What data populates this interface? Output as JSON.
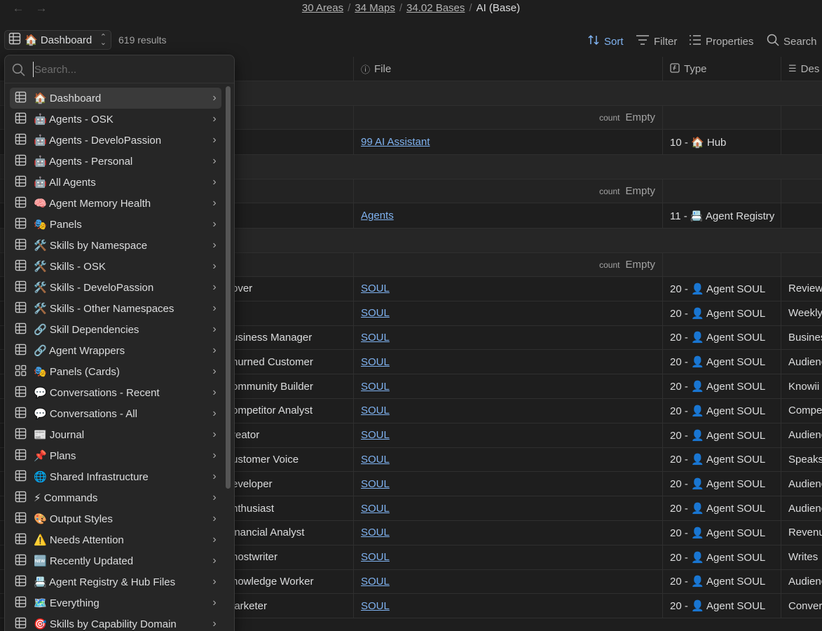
{
  "nav": {
    "back_icon": "arrow-left-icon",
    "forward_icon": "arrow-right-icon"
  },
  "breadcrumb": {
    "items": [
      "30 Areas",
      "34 Maps",
      "34.02 Bases"
    ],
    "current": "AI (Base)"
  },
  "toolbar": {
    "view_label": "🏠 Dashboard",
    "results": "619 results",
    "sort": "Sort",
    "filter": "Filter",
    "properties": "Properties",
    "search": "Search"
  },
  "table": {
    "headers": {
      "file": "File",
      "type": "Type",
      "description": "Des"
    },
    "summary": {
      "count_label": "count",
      "empty_label": "Empty"
    },
    "rows": [
      {
        "kind": "group"
      },
      {
        "kind": "summary"
      },
      {
        "kind": "data",
        "name": "",
        "file": "99 AI Assistant",
        "type": "10 - 🏠 Hub",
        "desc": ""
      },
      {
        "kind": "group"
      },
      {
        "kind": "summary"
      },
      {
        "kind": "data",
        "name": "",
        "file": "Agents",
        "type": "11 - 📇 Agent Registry",
        "desc": ""
      },
      {
        "kind": "group"
      },
      {
        "kind": "summary"
      },
      {
        "kind": "data",
        "name": "over",
        "file": "SOUL",
        "type": "20 - 👤 Agent SOUL",
        "desc": "Review"
      },
      {
        "kind": "data",
        "name": "",
        "file": "SOUL",
        "type": "20 - 👤 Agent SOUL",
        "desc": "Weekly"
      },
      {
        "kind": "data",
        "name": "usiness Manager",
        "file": "SOUL",
        "type": "20 - 👤 Agent SOUL",
        "desc": "Busines"
      },
      {
        "kind": "data",
        "name": "hurned Customer",
        "file": "SOUL",
        "type": "20 - 👤 Agent SOUL",
        "desc": "Audienc"
      },
      {
        "kind": "data",
        "name": "ommunity Builder",
        "file": "SOUL",
        "type": "20 - 👤 Agent SOUL",
        "desc": "Knowii"
      },
      {
        "kind": "data",
        "name": "ompetitor Analyst",
        "file": "SOUL",
        "type": "20 - 👤 Agent SOUL",
        "desc": "Compe"
      },
      {
        "kind": "data",
        "name": "reator",
        "file": "SOUL",
        "type": "20 - 👤 Agent SOUL",
        "desc": "Audienc"
      },
      {
        "kind": "data",
        "name": "ustomer Voice",
        "file": "SOUL",
        "type": "20 - 👤 Agent SOUL",
        "desc": "Speaks"
      },
      {
        "kind": "data",
        "name": "eveloper",
        "file": "SOUL",
        "type": "20 - 👤 Agent SOUL",
        "desc": "Audienc"
      },
      {
        "kind": "data",
        "name": "nthusiast",
        "file": "SOUL",
        "type": "20 - 👤 Agent SOUL",
        "desc": "Audienc"
      },
      {
        "kind": "data",
        "name": "inancial Analyst",
        "file": "SOUL",
        "type": "20 - 👤 Agent SOUL",
        "desc": "Revenu"
      },
      {
        "kind": "data",
        "name": "hostwriter",
        "file": "SOUL",
        "type": "20 - 👤 Agent SOUL",
        "desc": "Writes"
      },
      {
        "kind": "data",
        "name": "nowledge Worker",
        "file": "SOUL",
        "type": "20 - 👤 Agent SOUL",
        "desc": "Audienc"
      },
      {
        "kind": "data",
        "name": "larketer",
        "file": "SOUL",
        "type": "20 - 👤 Agent SOUL",
        "desc": "Conver"
      }
    ]
  },
  "dropdown": {
    "search_placeholder": "Search...",
    "items": [
      {
        "label": "🏠 Dashboard",
        "icon": "table-icon",
        "active": true
      },
      {
        "label": "🤖 Agents - OSK",
        "icon": "table-icon"
      },
      {
        "label": "🤖 Agents - DeveloPassion",
        "icon": "table-icon"
      },
      {
        "label": "🤖 Agents - Personal",
        "icon": "table-icon"
      },
      {
        "label": "🤖 All Agents",
        "icon": "table-icon"
      },
      {
        "label": "🧠 Agent Memory Health",
        "icon": "table-icon"
      },
      {
        "label": "🎭 Panels",
        "icon": "table-icon"
      },
      {
        "label": "🛠️ Skills by Namespace",
        "icon": "table-icon"
      },
      {
        "label": "🛠️ Skills - OSK",
        "icon": "table-icon"
      },
      {
        "label": "🛠️ Skills - DeveloPassion",
        "icon": "table-icon"
      },
      {
        "label": "🛠️ Skills - Other Namespaces",
        "icon": "table-icon"
      },
      {
        "label": "🔗 Skill Dependencies",
        "icon": "table-icon"
      },
      {
        "label": "🔗 Agent Wrappers",
        "icon": "table-icon"
      },
      {
        "label": "🎭 Panels (Cards)",
        "icon": "cards-icon"
      },
      {
        "label": "💬 Conversations - Recent",
        "icon": "table-icon"
      },
      {
        "label": "💬 Conversations - All",
        "icon": "table-icon"
      },
      {
        "label": "📰 Journal",
        "icon": "table-icon"
      },
      {
        "label": "📌 Plans",
        "icon": "table-icon"
      },
      {
        "label": "🌐 Shared Infrastructure",
        "icon": "table-icon"
      },
      {
        "label": "⚡ Commands",
        "icon": "table-icon"
      },
      {
        "label": "🎨 Output Styles",
        "icon": "table-icon"
      },
      {
        "label": "⚠️ Needs Attention",
        "icon": "table-icon"
      },
      {
        "label": "🆕 Recently Updated",
        "icon": "table-icon"
      },
      {
        "label": "📇 Agent Registry & Hub Files",
        "icon": "table-icon"
      },
      {
        "label": "🗺️ Everything",
        "icon": "table-icon"
      },
      {
        "label": "🎯 Skills by Capability Domain",
        "icon": "table-icon"
      }
    ]
  },
  "colors": {
    "background": "#1e1e1e",
    "accent": "#7fb2f0",
    "panel": "#262626"
  }
}
